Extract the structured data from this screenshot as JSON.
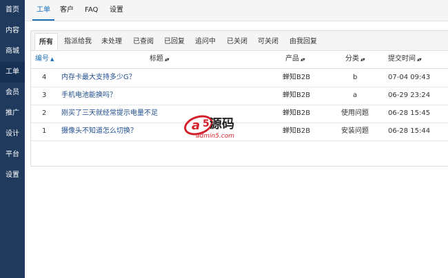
{
  "sidebar": {
    "items": [
      {
        "label": "首页"
      },
      {
        "label": "内容"
      },
      {
        "label": "商城"
      },
      {
        "label": "工单",
        "active": true
      },
      {
        "label": "会员"
      },
      {
        "label": "推广"
      },
      {
        "label": "设计"
      },
      {
        "label": "平台"
      },
      {
        "label": "设置"
      }
    ]
  },
  "topbar": {
    "tabs": [
      {
        "label": "工单",
        "active": true
      },
      {
        "label": "客户"
      },
      {
        "label": "FAQ"
      },
      {
        "label": "设置"
      }
    ]
  },
  "filters": {
    "tabs": [
      {
        "label": "所有",
        "active": true
      },
      {
        "label": "指派给我"
      },
      {
        "label": "未处理"
      },
      {
        "label": "已查阅"
      },
      {
        "label": "已回复"
      },
      {
        "label": "追问中"
      },
      {
        "label": "已关闭"
      },
      {
        "label": "可关闭"
      },
      {
        "label": "由我回复"
      }
    ]
  },
  "table": {
    "columns": [
      {
        "label": "编号",
        "sort": "asc"
      },
      {
        "label": "标题",
        "sort": "both"
      },
      {
        "label": "产品",
        "sort": "both"
      },
      {
        "label": "分类",
        "sort": "both"
      },
      {
        "label": "提交时间",
        "sort": "both"
      }
    ],
    "rows": [
      {
        "id": "4",
        "title": "内存卡最大支持多少G？",
        "product": "蝉知B2B",
        "category": "b",
        "time": "07-04 09:43"
      },
      {
        "id": "3",
        "title": "手机电池能换吗？",
        "product": "蝉知B2B",
        "category": "a",
        "time": "06-29 23:24"
      },
      {
        "id": "2",
        "title": "刚买了三天就经常提示电量不足",
        "product": "蝉知B2B",
        "category": "使用问题",
        "time": "06-28 15:45"
      },
      {
        "id": "1",
        "title": "摄像头不知道怎么切换？",
        "product": "蝉知B2B",
        "category": "安装问题",
        "time": "06-28 15:44"
      }
    ]
  },
  "watermark": {
    "brand": "a5源码",
    "domain": "admin5.com"
  },
  "colors": {
    "sidebar": "#1f3a5d",
    "accent": "#1c6fb8",
    "link": "#1f4e8c",
    "watermark_red": "#d4202a"
  }
}
